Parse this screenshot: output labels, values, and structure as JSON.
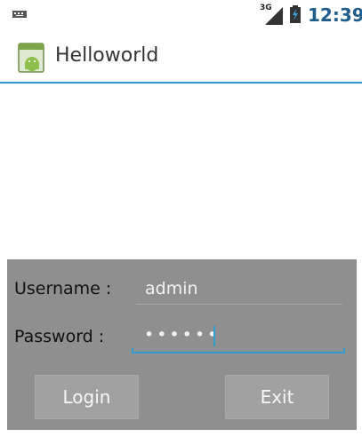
{
  "status_bar": {
    "time": "12:39",
    "network_type": "3G",
    "time_color": "#1e5c8c"
  },
  "action_bar": {
    "title": "Helloworld",
    "icon": "android-app-icon",
    "accent_color": "#2f9ad1"
  },
  "login": {
    "username_label": "Username :",
    "username_value": "admin",
    "password_label": "Password :",
    "password_masked": "••••••",
    "login_button": "Login",
    "exit_button": "Exit"
  }
}
